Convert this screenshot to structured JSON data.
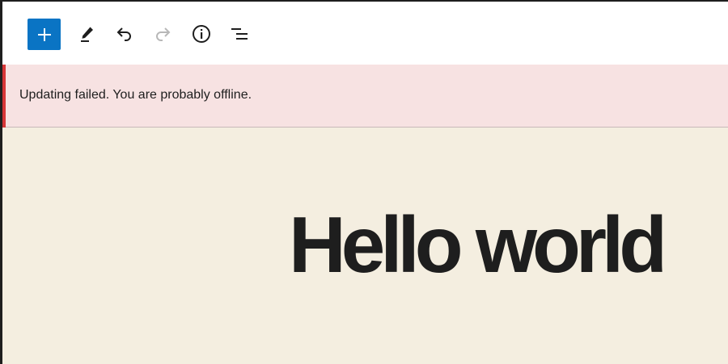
{
  "toolbar": {
    "buttons": [
      {
        "name": "add-block",
        "icon": "plus-icon"
      },
      {
        "name": "tools",
        "icon": "pencil-icon"
      },
      {
        "name": "undo",
        "icon": "undo-icon"
      },
      {
        "name": "redo",
        "icon": "redo-icon"
      },
      {
        "name": "details",
        "icon": "info-icon"
      },
      {
        "name": "list-view",
        "icon": "list-view-icon"
      }
    ],
    "colors": {
      "add_button_bg": "#0a74c4",
      "icon_active": "#1e1e1e",
      "icon_disabled": "#b8b8b8"
    }
  },
  "notice": {
    "message": "Updating failed. You are probably offline.",
    "status": "error",
    "colors": {
      "background": "#f7e2e2",
      "accent": "#d63638"
    }
  },
  "editor": {
    "post_title": "Hello world",
    "background": "#f4eee0"
  }
}
